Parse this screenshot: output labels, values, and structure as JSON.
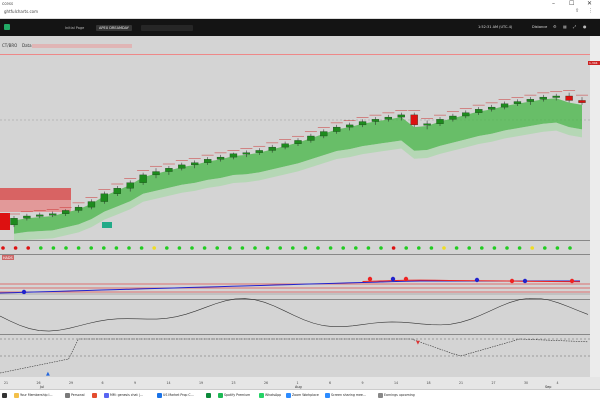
{
  "browser": {
    "tab_fragment": "ccess",
    "url": "ghtfulcharts.com",
    "controls": [
      "–",
      "☐",
      "✕"
    ]
  },
  "app": {
    "tabs": [
      "Initial Page",
      "APEX DREAMDAY",
      "",
      ""
    ],
    "clock": "1:52:31 AM  (UTC-4)",
    "status": "Distance"
  },
  "chart": {
    "symbol": "CT/BRO",
    "legend_label": "Data",
    "indicator_label": "HADS",
    "right_value_label": "1,304",
    "months": [
      "Jul",
      "Aug",
      "Sep"
    ],
    "ticks": [
      "21",
      "26",
      "29",
      "6",
      "9",
      "14",
      "19",
      "23",
      "26",
      "1",
      "6",
      "9",
      "14",
      "18",
      "21",
      "27",
      "30",
      "4"
    ],
    "colors": {
      "up": "#1e8a1e",
      "down": "#dd1111",
      "band": "#4cb84c",
      "blue_line": "#2222cc",
      "red_line": "#ee2222"
    }
  },
  "chart_data": {
    "type": "candlestick",
    "series": [
      {
        "name": "price",
        "ohlc": [
          [
            150,
            158,
            148,
            156
          ],
          [
            156,
            160,
            154,
            158
          ],
          [
            158,
            161,
            156,
            159
          ],
          [
            159,
            162,
            157,
            160
          ],
          [
            160,
            164,
            158,
            163
          ],
          [
            163,
            168,
            161,
            166
          ],
          [
            166,
            173,
            164,
            171
          ],
          [
            171,
            180,
            169,
            178
          ],
          [
            178,
            185,
            176,
            183
          ],
          [
            183,
            190,
            180,
            188
          ],
          [
            188,
            197,
            186,
            195
          ],
          [
            195,
            201,
            192,
            198
          ],
          [
            198,
            203,
            195,
            201
          ],
          [
            201,
            206,
            199,
            204
          ],
          [
            204,
            208,
            201,
            206
          ],
          [
            206,
            211,
            204,
            209
          ],
          [
            209,
            213,
            207,
            211
          ],
          [
            211,
            215,
            209,
            214
          ],
          [
            214,
            217,
            211,
            215
          ],
          [
            215,
            219,
            213,
            217
          ],
          [
            217,
            222,
            215,
            220
          ],
          [
            220,
            225,
            218,
            223
          ],
          [
            223,
            228,
            221,
            226
          ],
          [
            226,
            232,
            224,
            230
          ],
          [
            230,
            236,
            228,
            234
          ],
          [
            234,
            240,
            232,
            238
          ],
          [
            238,
            242,
            235,
            240
          ],
          [
            240,
            245,
            238,
            243
          ],
          [
            243,
            247,
            240,
            245
          ],
          [
            245,
            249,
            243,
            247
          ],
          [
            247,
            251,
            244,
            249
          ],
          [
            249,
            251,
            238,
            240
          ],
          [
            240,
            244,
            236,
            241
          ],
          [
            241,
            247,
            239,
            245
          ],
          [
            245,
            250,
            243,
            248
          ],
          [
            248,
            253,
            246,
            251
          ],
          [
            251,
            256,
            249,
            254
          ],
          [
            254,
            258,
            252,
            256
          ],
          [
            256,
            261,
            254,
            259
          ],
          [
            259,
            263,
            257,
            261
          ],
          [
            261,
            265,
            258,
            263
          ],
          [
            263,
            267,
            261,
            265
          ],
          [
            265,
            268,
            262,
            266
          ],
          [
            266,
            269,
            260,
            262
          ],
          [
            262,
            265,
            258,
            260
          ]
        ]
      }
    ]
  },
  "taskbar": {
    "items": [
      {
        "label": "",
        "color": "#333"
      },
      {
        "label": "Your Membership I...",
        "color": "#f3c04a"
      },
      {
        "label": "Personal",
        "color": "#7a7a7a"
      },
      {
        "label": "",
        "color": "#e34d2f"
      },
      {
        "label": "MM: genesis chat |...",
        "color": "#5865f2"
      },
      {
        "label": "US Market Prop C...",
        "color": "#1a73e8"
      },
      {
        "label": "",
        "color": "#0b8a3a"
      },
      {
        "label": "Spotify Premium",
        "color": "#1db954"
      },
      {
        "label": "WhatsApp",
        "color": "#25d366"
      },
      {
        "label": "Zoom Workplace",
        "color": "#2d8cff"
      },
      {
        "label": "Screen sharing mee...",
        "color": "#2d8cff"
      },
      {
        "label": "Earnings upcoming",
        "color": "#888"
      }
    ]
  }
}
